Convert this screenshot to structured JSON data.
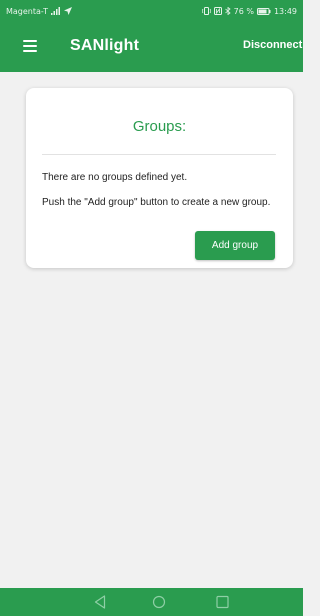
{
  "status_bar": {
    "carrier": "Magenta-T",
    "battery_percent": "76 %",
    "time": "13:49",
    "icons": [
      "signal-icon",
      "location-arrow-icon",
      "vibrate-icon",
      "nfc-icon",
      "bluetooth-icon",
      "battery-icon"
    ]
  },
  "app_bar": {
    "title": "SANlight",
    "action": "Disconnect",
    "menu_icon": "hamburger-menu-icon"
  },
  "groups_card": {
    "title": "Groups:",
    "empty_message": "There are no groups defined yet.",
    "hint": "Push the \"Add group\" button to create a new group.",
    "add_button_label": "Add group"
  },
  "nav_bar": {
    "buttons": [
      "back-icon",
      "home-icon",
      "recents-icon"
    ]
  },
  "colors": {
    "accent": "#2a9c4f",
    "background": "#f1f1f1",
    "card": "#ffffff"
  }
}
